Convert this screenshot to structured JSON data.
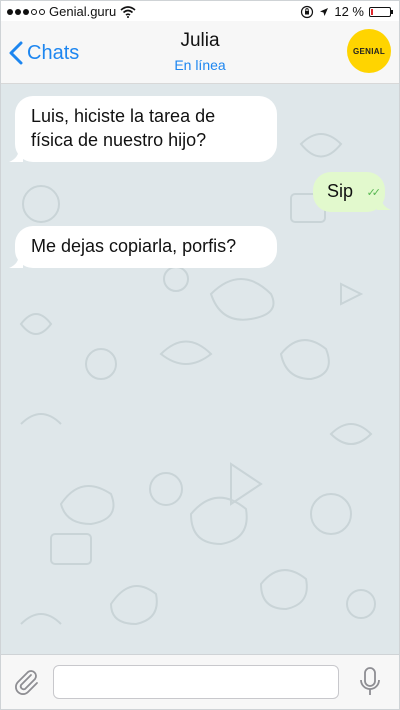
{
  "status_bar": {
    "carrier": "Genial.guru",
    "battery_text": "12 %",
    "battery_level": 0.12,
    "signal_bars_filled": 3,
    "signal_bars_total": 5
  },
  "header": {
    "back_label": "Chats",
    "contact_name": "Julia",
    "contact_status": "En línea",
    "avatar_text": "GENIAL"
  },
  "messages": [
    {
      "direction": "incoming",
      "text_line1": "Luis, hiciste la tarea de",
      "text_line2": "física de nuestro hijo?"
    },
    {
      "direction": "outgoing",
      "text": "Sip",
      "read": true
    },
    {
      "direction": "incoming",
      "text": "Me dejas copiarla, porfis?"
    }
  ],
  "input": {
    "value": ""
  },
  "colors": {
    "accent": "#1d86f0",
    "outgoing_bubble": "#e2f9cd",
    "incoming_bubble": "#ffffff",
    "chat_background": "#dfe7ea",
    "brand_logo": "#ffd400"
  },
  "icons": [
    "wifi-icon",
    "lock-rotation-icon",
    "battery-icon",
    "chevron-left-icon",
    "paperclip-icon",
    "microphone-icon",
    "double-check-icon"
  ]
}
